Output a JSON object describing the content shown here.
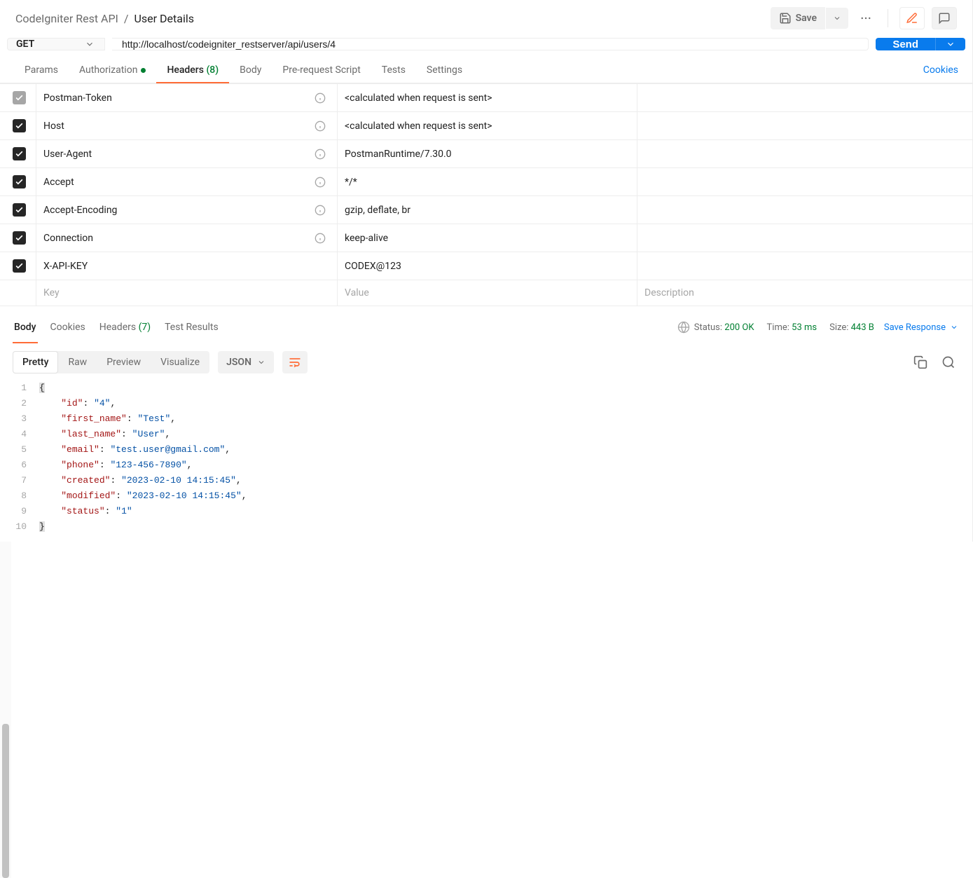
{
  "breadcrumb": {
    "parent": "CodeIgniter Rest API",
    "sep": "/",
    "current": "User Details"
  },
  "topbar": {
    "save": "Save"
  },
  "request": {
    "method": "GET",
    "url": "http://localhost/codeigniter_restserver/api/users/4",
    "send": "Send"
  },
  "req_tabs": {
    "params": "Params",
    "auth": "Authorization",
    "headers": "Headers",
    "headers_count": "(8)",
    "body": "Body",
    "prereq": "Pre-request Script",
    "tests": "Tests",
    "settings": "Settings",
    "cookies": "Cookies"
  },
  "headers_rows": [
    {
      "key": "Postman-Token",
      "val": "<calculated when request is sent>",
      "info": true,
      "state": "disabled"
    },
    {
      "key": "Host",
      "val": "<calculated when request is sent>",
      "info": true,
      "state": "on"
    },
    {
      "key": "User-Agent",
      "val": "PostmanRuntime/7.30.0",
      "info": true,
      "state": "on"
    },
    {
      "key": "Accept",
      "val": "*/*",
      "info": true,
      "state": "on"
    },
    {
      "key": "Accept-Encoding",
      "val": "gzip, deflate, br",
      "info": true,
      "state": "on"
    },
    {
      "key": "Connection",
      "val": "keep-alive",
      "info": true,
      "state": "on"
    },
    {
      "key": "X-API-KEY",
      "val": "CODEX@123",
      "info": false,
      "state": "on"
    }
  ],
  "headers_ph": {
    "key": "Key",
    "val": "Value",
    "desc": "Description"
  },
  "res_tabs": {
    "body": "Body",
    "cookies": "Cookies",
    "headers": "Headers",
    "headers_count": "(7)",
    "test_results": "Test Results"
  },
  "status": {
    "status_lbl": "Status:",
    "status_val": "200 OK",
    "time_lbl": "Time:",
    "time_val": "53 ms",
    "size_lbl": "Size:",
    "size_val": "443 B",
    "save_resp": "Save Response"
  },
  "pretty": {
    "pretty": "Pretty",
    "raw": "Raw",
    "preview": "Preview",
    "visualize": "Visualize",
    "format": "JSON"
  },
  "body_json": {
    "id": "4",
    "first_name": "Test",
    "last_name": "User",
    "email": "test.user@gmail.com",
    "phone": "123-456-7890",
    "created": "2023-02-10 14:15:45",
    "modified": "2023-02-10 14:15:45",
    "status": "1"
  }
}
